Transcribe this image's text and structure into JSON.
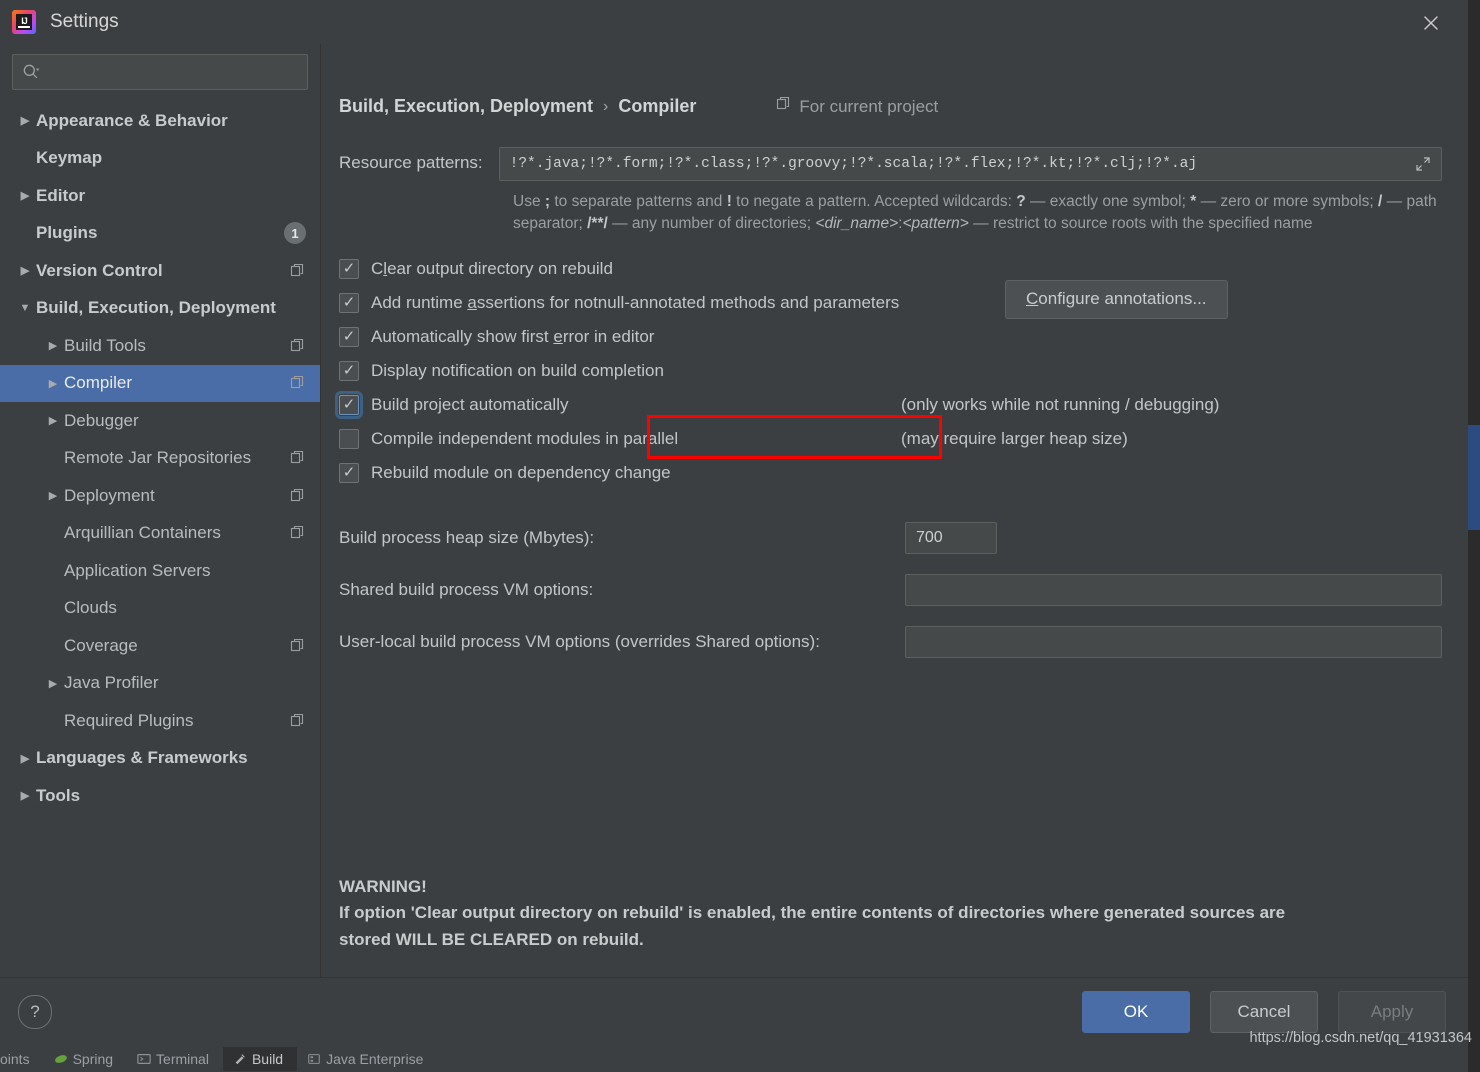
{
  "window": {
    "title": "Settings",
    "close_icon": "close-icon",
    "app_icon": "intellij-idea-icon"
  },
  "sidebar": {
    "search": {
      "placeholder": "",
      "value": "",
      "icon": "search-icon"
    },
    "items": [
      {
        "label": "Appearance & Behavior",
        "arrow": "collapsed",
        "indent": 0,
        "bold": true,
        "badge": "",
        "copy": false,
        "selected": false
      },
      {
        "label": "Keymap",
        "arrow": "none",
        "indent": 0,
        "bold": true,
        "badge": "",
        "copy": false,
        "selected": false
      },
      {
        "label": "Editor",
        "arrow": "collapsed",
        "indent": 0,
        "bold": true,
        "badge": "",
        "copy": false,
        "selected": false
      },
      {
        "label": "Plugins",
        "arrow": "none",
        "indent": 0,
        "bold": true,
        "badge": "1",
        "copy": false,
        "selected": false
      },
      {
        "label": "Version Control",
        "arrow": "collapsed",
        "indent": 0,
        "bold": true,
        "badge": "",
        "copy": true,
        "selected": false
      },
      {
        "label": "Build, Execution, Deployment",
        "arrow": "expanded",
        "indent": 0,
        "bold": true,
        "badge": "",
        "copy": false,
        "selected": false
      },
      {
        "label": "Build Tools",
        "arrow": "collapsed",
        "indent": 1,
        "bold": false,
        "badge": "",
        "copy": true,
        "selected": false
      },
      {
        "label": "Compiler",
        "arrow": "collapsed",
        "indent": 1,
        "bold": false,
        "badge": "",
        "copy": true,
        "selected": true
      },
      {
        "label": "Debugger",
        "arrow": "collapsed",
        "indent": 1,
        "bold": false,
        "badge": "",
        "copy": false,
        "selected": false
      },
      {
        "label": "Remote Jar Repositories",
        "arrow": "none",
        "indent": 1,
        "bold": false,
        "badge": "",
        "copy": true,
        "selected": false
      },
      {
        "label": "Deployment",
        "arrow": "collapsed",
        "indent": 1,
        "bold": false,
        "badge": "",
        "copy": true,
        "selected": false
      },
      {
        "label": "Arquillian Containers",
        "arrow": "none",
        "indent": 1,
        "bold": false,
        "badge": "",
        "copy": true,
        "selected": false
      },
      {
        "label": "Application Servers",
        "arrow": "none",
        "indent": 1,
        "bold": false,
        "badge": "",
        "copy": false,
        "selected": false
      },
      {
        "label": "Clouds",
        "arrow": "none",
        "indent": 1,
        "bold": false,
        "badge": "",
        "copy": false,
        "selected": false
      },
      {
        "label": "Coverage",
        "arrow": "none",
        "indent": 1,
        "bold": false,
        "badge": "",
        "copy": true,
        "selected": false
      },
      {
        "label": "Java Profiler",
        "arrow": "collapsed",
        "indent": 1,
        "bold": false,
        "badge": "",
        "copy": false,
        "selected": false
      },
      {
        "label": "Required Plugins",
        "arrow": "none",
        "indent": 1,
        "bold": false,
        "badge": "",
        "copy": true,
        "selected": false
      },
      {
        "label": "Languages & Frameworks",
        "arrow": "collapsed",
        "indent": 0,
        "bold": true,
        "badge": "",
        "copy": false,
        "selected": false
      },
      {
        "label": "Tools",
        "arrow": "collapsed",
        "indent": 0,
        "bold": true,
        "badge": "",
        "copy": false,
        "selected": false
      }
    ]
  },
  "content": {
    "breadcrumb": {
      "parent": "Build, Execution, Deployment",
      "separator": "›",
      "current": "Compiler"
    },
    "for_current_project": {
      "label": "For current project",
      "icon": "copy-project-icon"
    },
    "resource_patterns": {
      "label": "Resource patterns:",
      "value": "!?*.java;!?*.form;!?*.class;!?*.groovy;!?*.scala;!?*.flex;!?*.kt;!?*.clj;!?*.aj",
      "expand_icon": "expand-icon"
    },
    "hint": {
      "line1_a": "Use ",
      "line1_semicolon": ";",
      "line1_b": " to separate patterns and ",
      "line1_bang": "!",
      "line1_c": " to negate a pattern. Accepted wildcards: ",
      "line1_q": "?",
      "line1_d": " — exactly one symbol; ",
      "line1_star": "*",
      "line1_e": " — zero or more symbols; ",
      "line2_slash": "/",
      "line2_a": " — path separator; ",
      "line2_globstar": "/**/",
      "line2_b": " — any number of directories; ",
      "line2_dir": "<dir_name>",
      "line2_colon": ":",
      "line2_pattern": "<pattern>",
      "line2_c": " — restrict to source roots with the specified name"
    },
    "checkboxes": [
      {
        "label_pre": "C",
        "label_underline": "l",
        "label_post": "ear output directory on rebuild",
        "checked": true,
        "focused": false,
        "note": "",
        "button": ""
      },
      {
        "label_pre": "Add runtime ",
        "label_underline": "a",
        "label_post": "ssertions for notnull-annotated methods and parameters",
        "checked": true,
        "focused": false,
        "note": "",
        "button": "Configure annotations...",
        "button_underline": "C",
        "button_pre": "",
        "button_post": "onfigure annotations..."
      },
      {
        "label_pre": "Automatically show first ",
        "label_underline": "e",
        "label_post": "rror in editor",
        "checked": true,
        "focused": false,
        "note": "",
        "button": ""
      },
      {
        "label_pre": "Display notification on build completion",
        "label_underline": "",
        "label_post": "",
        "checked": true,
        "focused": false,
        "note": "",
        "button": ""
      },
      {
        "label_pre": "Build project automatically",
        "label_underline": "",
        "label_post": "",
        "checked": true,
        "focused": true,
        "note": "(only works while not running / debugging)",
        "button": ""
      },
      {
        "label_pre": "Compile independent modules in parallel",
        "label_underline": "",
        "label_post": "",
        "checked": false,
        "focused": false,
        "note": "(may require larger heap size)",
        "button": ""
      },
      {
        "label_pre": "Rebuild module on dependency change",
        "label_underline": "",
        "label_post": "",
        "checked": true,
        "focused": false,
        "note": "",
        "button": ""
      }
    ],
    "fields": [
      {
        "label": "Build process heap size (Mbytes):",
        "value": "700",
        "width": "small"
      },
      {
        "label": "Shared build process VM options:",
        "value": "",
        "width": "wide"
      },
      {
        "label": "User-local build process VM options (overrides Shared options):",
        "value": "",
        "width": "wide"
      }
    ],
    "warning": {
      "title": "WARNING!",
      "line1": "If option 'Clear output directory on rebuild' is enabled, the entire contents of directories where generated sources are",
      "line2": "stored WILL BE CLEARED on rebuild."
    }
  },
  "footer": {
    "help_label": "?",
    "ok": "OK",
    "cancel": "Cancel",
    "apply": "Apply"
  },
  "background": {
    "toolwindow_tabs": [
      {
        "label": "oints",
        "icon": "",
        "active": false
      },
      {
        "label": "Spring",
        "icon": "spring-icon",
        "active": false
      },
      {
        "label": "Terminal",
        "icon": "terminal-icon",
        "active": false
      },
      {
        "label": "Build",
        "icon": "build-icon",
        "active": true
      },
      {
        "label": "Java Enterprise",
        "icon": "java-enterprise-icon",
        "active": false
      }
    ]
  },
  "watermark": "https://blog.csdn.net/qq_41931364",
  "colors": {
    "accent": "#4a6da7",
    "annotation": "#ff0000",
    "panel": "#3c3f41",
    "field": "#45494a"
  }
}
